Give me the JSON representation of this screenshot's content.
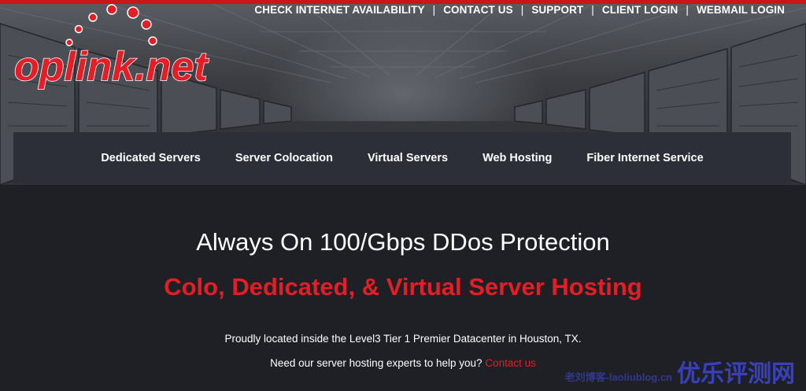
{
  "header": {
    "logo_text": "oplink.net",
    "top_links": [
      {
        "label": "CHECK INTERNET AVAILABILITY"
      },
      {
        "label": "CONTACT US"
      },
      {
        "label": "SUPPORT"
      },
      {
        "label": "CLIENT LOGIN"
      },
      {
        "label": "WEBMAIL LOGIN"
      }
    ],
    "separator": "|"
  },
  "nav": {
    "items": [
      {
        "label": "Dedicated Servers"
      },
      {
        "label": "Server Colocation"
      },
      {
        "label": "Virtual Servers"
      },
      {
        "label": "Web Hosting"
      },
      {
        "label": "Fiber Internet Service"
      }
    ]
  },
  "main": {
    "headline": "Always On 100/Gbps DDos Protection",
    "subhead": "Colo, Dedicated, & Virtual Server Hosting",
    "location_text": "Proudly located inside the Level3 Tier 1 Premier Datacenter in Houston, TX.",
    "help_text": "Need our server hosting experts to help you?",
    "contact_link": "Contact us"
  },
  "watermark": {
    "small": "老刘博客-laoliublog.cn",
    "big": "优乐评测网"
  },
  "colors": {
    "accent_red": "#e41e26",
    "page_bg": "#1e2026",
    "nav_bg": "#2c2f37"
  }
}
